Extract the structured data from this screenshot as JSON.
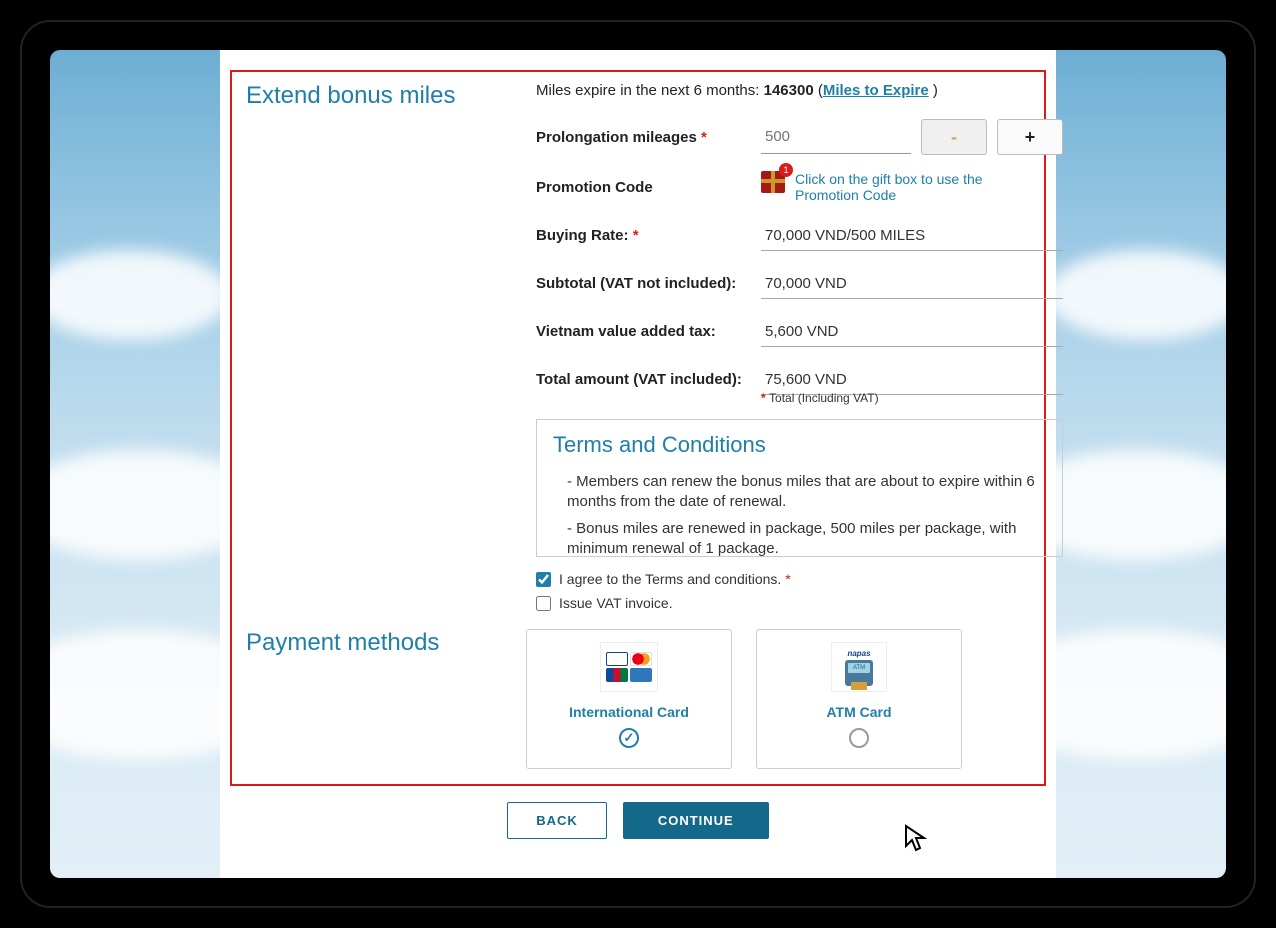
{
  "section": {
    "extend_title": "Extend bonus miles",
    "payment_title": "Payment methods"
  },
  "expire": {
    "prefix": "Miles expire in the next 6 months: ",
    "value": "146300",
    "link": "Miles to Expire"
  },
  "labels": {
    "prolongation": "Prolongation mileages ",
    "promo": "Promotion Code",
    "buying_rate": "Buying Rate: ",
    "subtotal": "Subtotal (VAT not included):",
    "vat": "Vietnam value added tax:",
    "total": "Total amount (VAT included):",
    "total_note": "Total (Including VAT)"
  },
  "fields": {
    "mileage_placeholder": "500",
    "promo_hint": "Click on the gift box to use the Promotion Code",
    "gift_badge": "1",
    "buying_rate": "70,000 VND/500 MILES",
    "subtotal": "70,000 VND",
    "vat": "5,600 VND",
    "total": "75,600 VND"
  },
  "stepper": {
    "minus": "-",
    "plus": "+"
  },
  "terms": {
    "title": "Terms and Conditions",
    "items": [
      "Members can renew the bonus miles that are about to expire within 6 months from the date of renewal.",
      "Bonus miles are renewed in package, 500 miles per package, with minimum renewal of 1 package."
    ]
  },
  "checks": {
    "agree": "I agree to the Terms and conditions. ",
    "invoice": "Issue VAT invoice."
  },
  "payment": {
    "intl": "International Card",
    "atm": "ATM Card",
    "napas": "napas"
  },
  "buttons": {
    "back": "BACK",
    "continue": "CONTINUE"
  }
}
